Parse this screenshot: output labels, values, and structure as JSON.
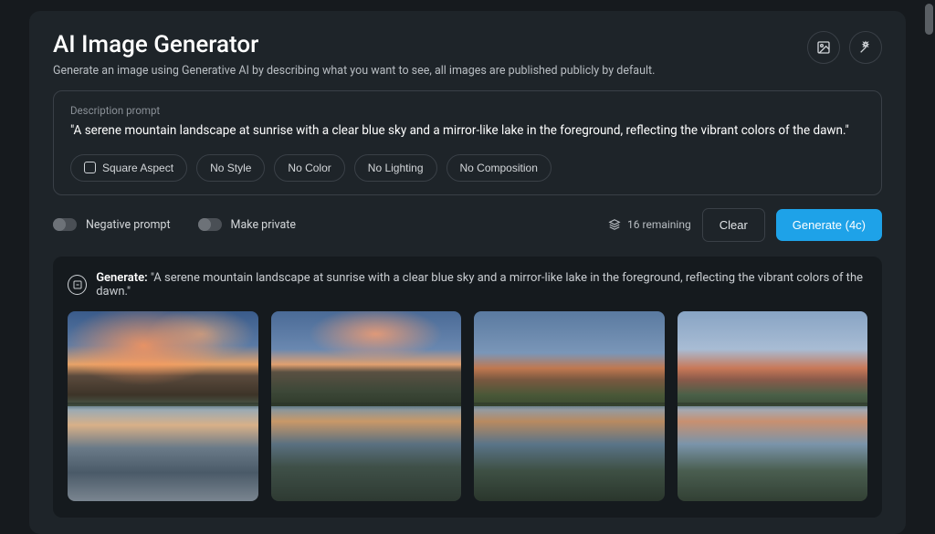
{
  "header": {
    "title": "AI Image Generator",
    "subtitle": "Generate an image using Generative AI by describing what you want to see, all images are published publicly by default."
  },
  "prompt": {
    "label": "Description prompt",
    "value": "\"A serene mountain landscape at sunrise with a clear blue sky and a mirror-like lake in the foreground, reflecting the vibrant colors of the dawn.\""
  },
  "chips": {
    "square_aspect": "Square Aspect",
    "no_style": "No Style",
    "no_color": "No Color",
    "no_lighting": "No Lighting",
    "no_composition": "No Composition"
  },
  "toggles": {
    "negative_prompt": "Negative prompt",
    "make_private": "Make private"
  },
  "credits": {
    "remaining": "16 remaining"
  },
  "buttons": {
    "clear": "Clear",
    "generate": "Generate (4c)"
  },
  "results": {
    "label": "Generate:",
    "prompt_echo": "\"A serene mountain landscape at sunrise with a clear blue sky and a mirror-like lake in the foreground, reflecting the vibrant colors of the dawn.\""
  },
  "colors": {
    "accent": "#1ea2e8"
  }
}
